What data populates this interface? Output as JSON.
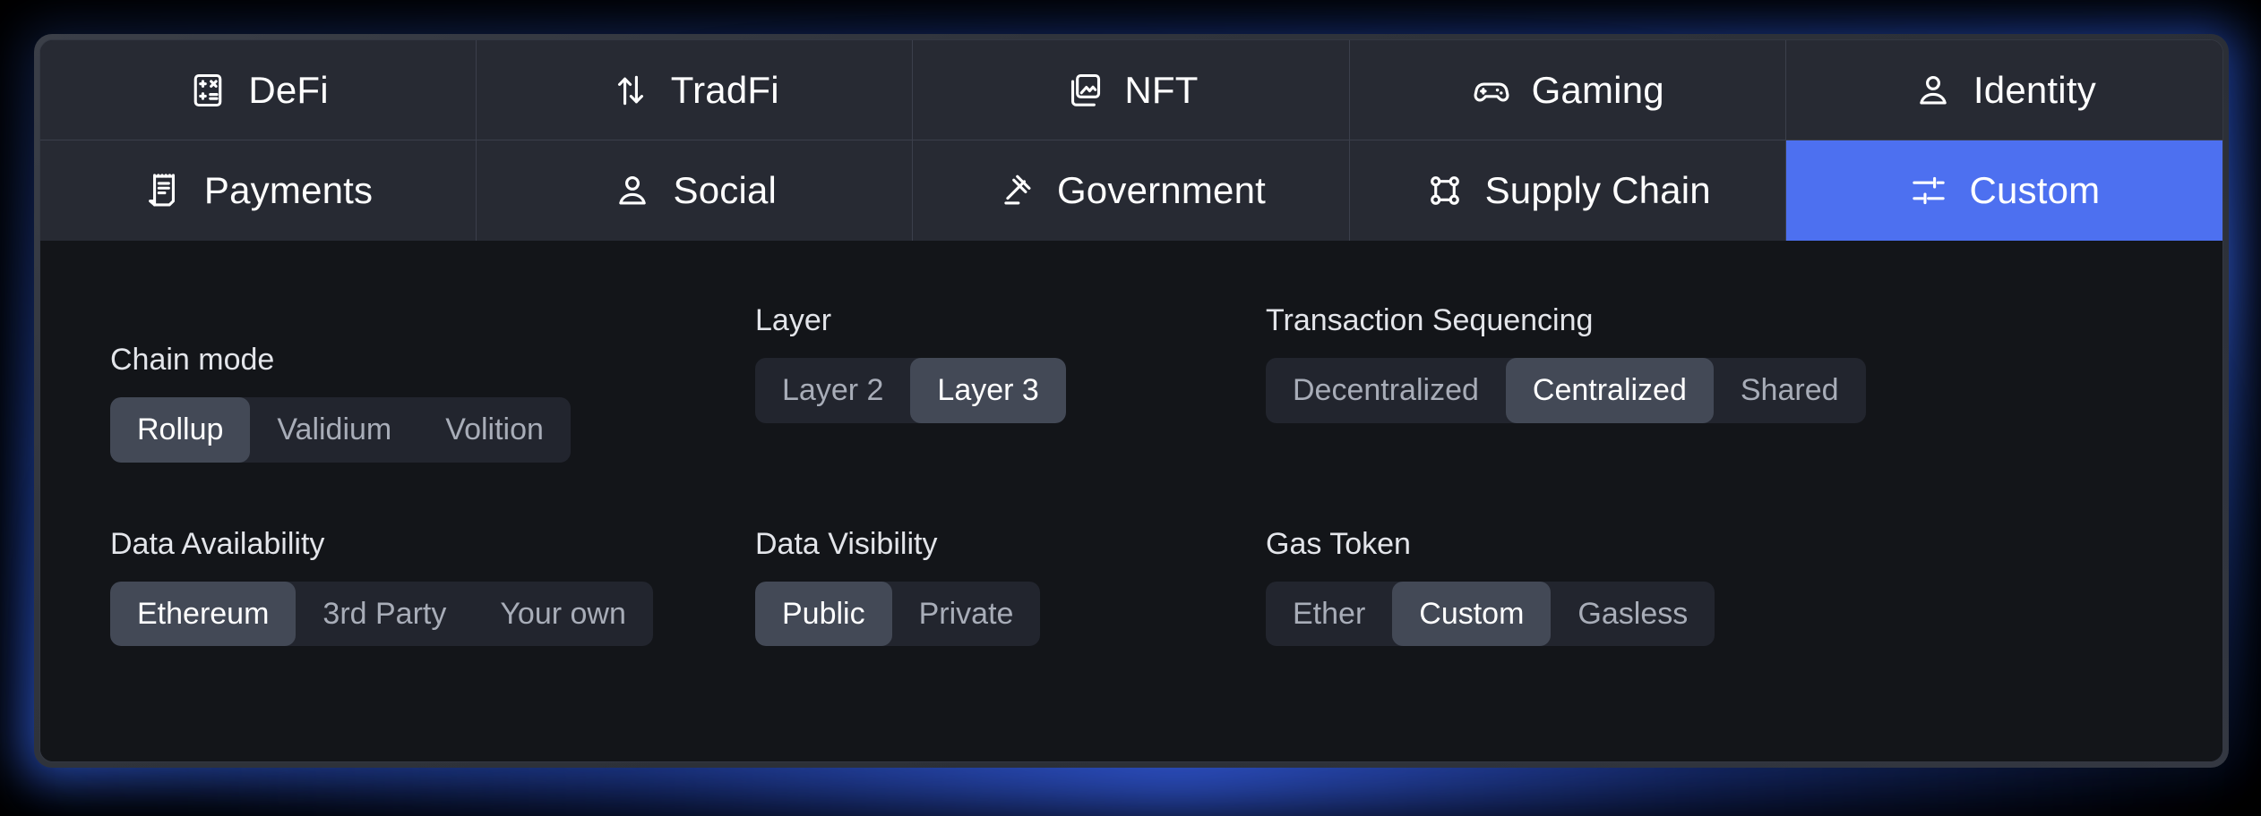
{
  "theme": {
    "accent": "#4d70f0",
    "tab_bg": "#272a33",
    "panel_bg": "#131519",
    "segment_track": "#22252e",
    "segment_selected": "#434956",
    "text_primary": "#ffffff",
    "text_muted": "#a8adb8"
  },
  "tabs": [
    {
      "label": "DeFi",
      "icon": "calculator-icon",
      "active": false
    },
    {
      "label": "TradFi",
      "icon": "swap-vertical-icon",
      "active": false
    },
    {
      "label": "NFT",
      "icon": "images-icon",
      "active": false
    },
    {
      "label": "Gaming",
      "icon": "gamepad-icon",
      "active": false
    },
    {
      "label": "Identity",
      "icon": "person-icon",
      "active": false
    },
    {
      "label": "Payments",
      "icon": "receipt-icon",
      "active": false
    },
    {
      "label": "Social",
      "icon": "person-icon",
      "active": false
    },
    {
      "label": "Government",
      "icon": "gavel-icon",
      "active": false
    },
    {
      "label": "Supply Chain",
      "icon": "nodes-square-icon",
      "active": false
    },
    {
      "label": "Custom",
      "icon": "sliders-icon",
      "active": true
    }
  ],
  "settings": [
    {
      "label": "Chain mode",
      "options": [
        "Rollup",
        "Validium",
        "Volition"
      ],
      "selected": "Rollup"
    },
    {
      "label": "Layer",
      "options": [
        "Layer 2",
        "Layer 3"
      ],
      "selected": "Layer 3"
    },
    {
      "label": "Transaction Sequencing",
      "options": [
        "Decentralized",
        "Centralized",
        "Shared"
      ],
      "selected": "Centralized"
    },
    {
      "label": "Data Availability",
      "options": [
        "Ethereum",
        "3rd Party",
        "Your own"
      ],
      "selected": "Ethereum"
    },
    {
      "label": "Data Visibility",
      "options": [
        "Public",
        "Private"
      ],
      "selected": "Public"
    },
    {
      "label": "Gas Token",
      "options": [
        "Ether",
        "Custom",
        "Gasless"
      ],
      "selected": "Custom"
    }
  ]
}
